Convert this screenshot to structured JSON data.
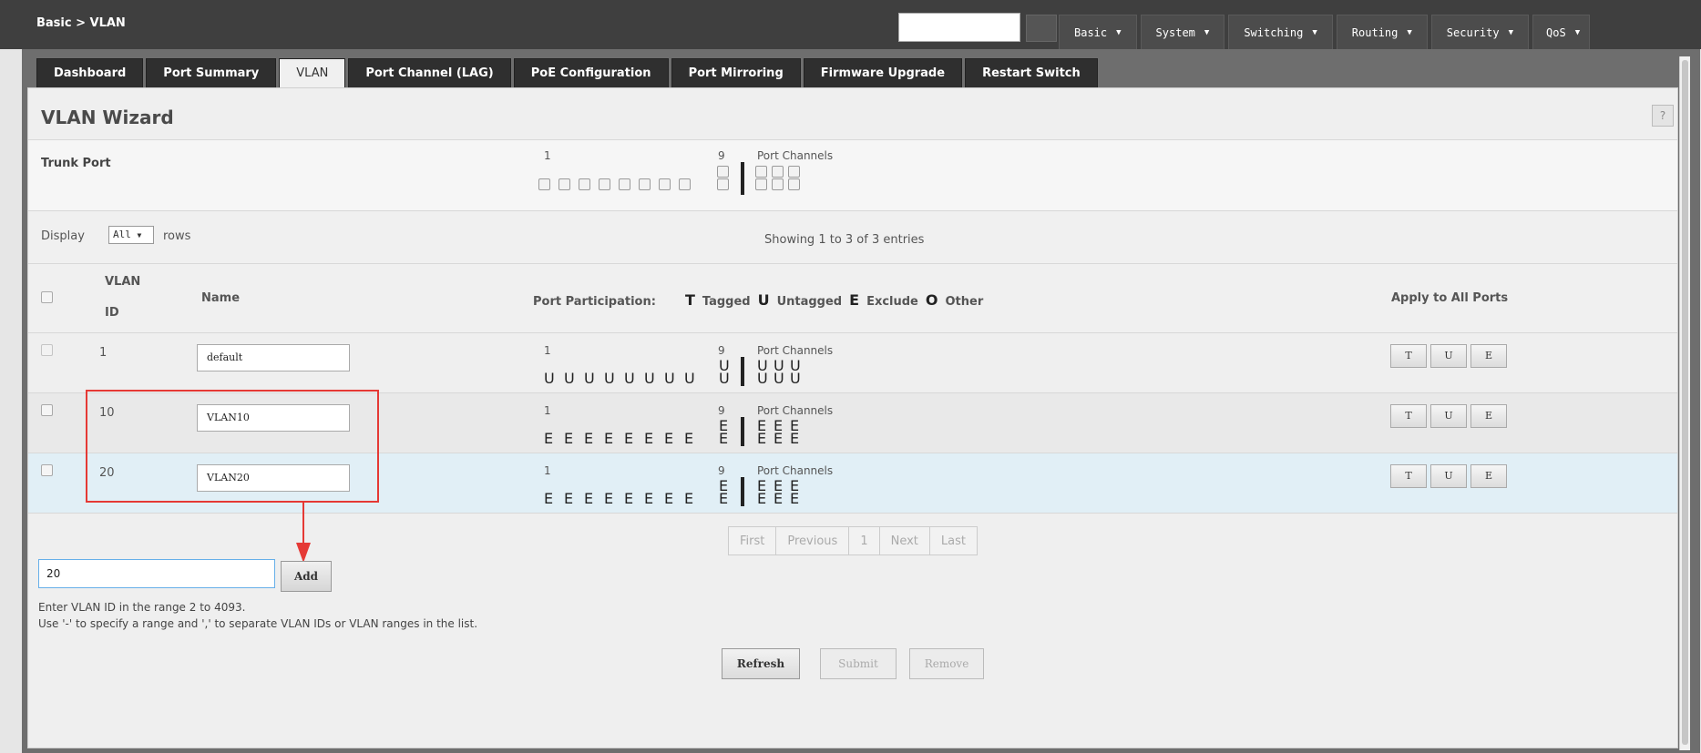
{
  "breadcrumb": "Basic > VLAN",
  "top_menu": [
    {
      "label": "Basic"
    },
    {
      "label": "System"
    },
    {
      "label": "Switching"
    },
    {
      "label": "Routing"
    },
    {
      "label": "Security"
    },
    {
      "label": "QoS"
    }
  ],
  "tabs": [
    {
      "label": "Dashboard",
      "active": false
    },
    {
      "label": "Port Summary",
      "active": false
    },
    {
      "label": "VLAN",
      "active": true
    },
    {
      "label": "Port Channel (LAG)",
      "active": false
    },
    {
      "label": "PoE Configuration",
      "active": false
    },
    {
      "label": "Port Mirroring",
      "active": false
    },
    {
      "label": "Firmware Upgrade",
      "active": false
    },
    {
      "label": "Restart Switch",
      "active": false
    }
  ],
  "wizard": {
    "title": "VLAN Wizard",
    "help": "?",
    "trunk_label": "Trunk Port",
    "port_start": "1",
    "port_nine": "9",
    "port_channels": "Port Channels"
  },
  "display": {
    "label": "Display",
    "select_value": "All",
    "rows_label": "rows",
    "showing": "Showing 1 to 3 of 3 entries"
  },
  "table": {
    "col_vlan": "VLAN",
    "col_id": "ID",
    "col_name": "Name",
    "col_participation": "Port Participation:",
    "col_apply": "Apply to All Ports",
    "legend": [
      {
        "key": "T",
        "label": "Tagged"
      },
      {
        "key": "U",
        "label": "Untagged"
      },
      {
        "key": "E",
        "label": "Exclude"
      },
      {
        "key": "O",
        "label": "Other"
      }
    ],
    "rows": [
      {
        "id": "1",
        "name": "default",
        "ports": [
          "U",
          "U",
          "U",
          "U",
          "U",
          "U",
          "U",
          "U"
        ],
        "port9": [
          "U",
          "U"
        ],
        "channels": [
          "U",
          "U",
          "U",
          "U",
          "U",
          "U"
        ]
      },
      {
        "id": "10",
        "name": "VLAN10",
        "ports": [
          "E",
          "E",
          "E",
          "E",
          "E",
          "E",
          "E",
          "E"
        ],
        "port9": [
          "E",
          "E"
        ],
        "channels": [
          "E",
          "E",
          "E",
          "E",
          "E",
          "E"
        ]
      },
      {
        "id": "20",
        "name": "VLAN20",
        "ports": [
          "E",
          "E",
          "E",
          "E",
          "E",
          "E",
          "E",
          "E"
        ],
        "port9": [
          "E",
          "E"
        ],
        "channels": [
          "E",
          "E",
          "E",
          "E",
          "E",
          "E"
        ]
      }
    ],
    "apply_buttons": [
      "T",
      "U",
      "E"
    ]
  },
  "pager": [
    "First",
    "Previous",
    "1",
    "Next",
    "Last"
  ],
  "add": {
    "value": "20",
    "button": "Add",
    "hint1": "Enter VLAN ID in the range 2 to 4093.",
    "hint2": "Use '-' to specify a range and ',' to separate VLAN IDs or VLAN ranges in the list."
  },
  "actions": {
    "refresh": "Refresh",
    "submit": "Submit",
    "remove": "Remove"
  },
  "colors": {
    "highlight": "#e53935",
    "topbar": "#3f3f3f",
    "selected_row": "#e1eff6"
  }
}
